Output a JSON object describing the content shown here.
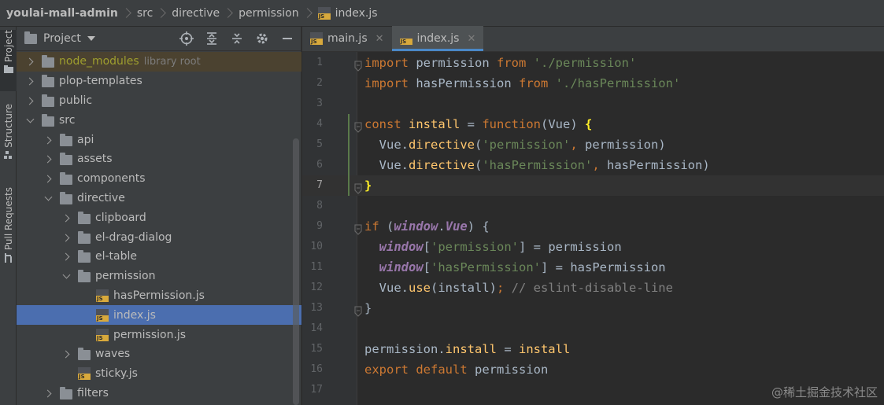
{
  "breadcrumb": {
    "items": [
      "youlai-mall-admin",
      "src",
      "directive",
      "permission",
      "index.js"
    ]
  },
  "toolstrip": {
    "tabs": [
      "Project",
      "Structure",
      "Pull Requests"
    ]
  },
  "project": {
    "title": "Project",
    "tree": [
      {
        "label": "node_modules",
        "extra": "library root",
        "depth": 1,
        "state": "collapsed",
        "type": "folder",
        "excluded": true
      },
      {
        "label": "plop-templates",
        "depth": 1,
        "state": "collapsed",
        "type": "folder"
      },
      {
        "label": "public",
        "depth": 1,
        "state": "collapsed",
        "type": "folder"
      },
      {
        "label": "src",
        "depth": 1,
        "state": "expanded",
        "type": "folder"
      },
      {
        "label": "api",
        "depth": 2,
        "state": "collapsed",
        "type": "folder"
      },
      {
        "label": "assets",
        "depth": 2,
        "state": "collapsed",
        "type": "folder"
      },
      {
        "label": "components",
        "depth": 2,
        "state": "collapsed",
        "type": "folder"
      },
      {
        "label": "directive",
        "depth": 2,
        "state": "expanded",
        "type": "folder"
      },
      {
        "label": "clipboard",
        "depth": 3,
        "state": "collapsed",
        "type": "folder"
      },
      {
        "label": "el-drag-dialog",
        "depth": 3,
        "state": "collapsed",
        "type": "folder"
      },
      {
        "label": "el-table",
        "depth": 3,
        "state": "collapsed",
        "type": "folder"
      },
      {
        "label": "permission",
        "depth": 3,
        "state": "expanded",
        "type": "folder"
      },
      {
        "label": "hasPermission.js",
        "depth": 4,
        "state": "none",
        "type": "js"
      },
      {
        "label": "index.js",
        "depth": 4,
        "state": "none",
        "type": "js",
        "selected": true
      },
      {
        "label": "permission.js",
        "depth": 4,
        "state": "none",
        "type": "js"
      },
      {
        "label": "waves",
        "depth": 3,
        "state": "collapsed",
        "type": "folder"
      },
      {
        "label": "sticky.js",
        "depth": 3,
        "state": "none",
        "type": "js"
      },
      {
        "label": "filters",
        "depth": 2,
        "state": "collapsed",
        "type": "folder"
      }
    ]
  },
  "editor": {
    "tabs": [
      {
        "label": "main.js",
        "active": false
      },
      {
        "label": "index.js",
        "active": true
      }
    ],
    "current_line": 7,
    "lines": [
      [
        [
          "kw",
          "import"
        ],
        [
          "t",
          " permission "
        ],
        [
          "kw",
          "from"
        ],
        [
          "t",
          " "
        ],
        [
          "str",
          "'./permission'"
        ]
      ],
      [
        [
          "kw",
          "import"
        ],
        [
          "t",
          " hasPermission "
        ],
        [
          "kw",
          "from"
        ],
        [
          "t",
          " "
        ],
        [
          "str",
          "'./hasPermission'"
        ]
      ],
      [],
      [
        [
          "kw",
          "const"
        ],
        [
          "t",
          " "
        ],
        [
          "fn",
          "install"
        ],
        [
          "t",
          " = "
        ],
        [
          "kw",
          "function"
        ],
        [
          "t",
          "(Vue) "
        ],
        [
          "brace",
          "{"
        ]
      ],
      [
        [
          "t",
          "  Vue."
        ],
        [
          "fn",
          "directive"
        ],
        [
          "t",
          "("
        ],
        [
          "str",
          "'permission'"
        ],
        [
          "kw",
          ","
        ],
        [
          "t",
          " permission)"
        ]
      ],
      [
        [
          "t",
          "  Vue."
        ],
        [
          "fn",
          "directive"
        ],
        [
          "t",
          "("
        ],
        [
          "str",
          "'hasPermission'"
        ],
        [
          "kw",
          ","
        ],
        [
          "t",
          " hasPermission)"
        ]
      ],
      [
        [
          "brace",
          "}"
        ]
      ],
      [],
      [
        [
          "kw",
          "if"
        ],
        [
          "t",
          " ("
        ],
        [
          "ivar",
          "window"
        ],
        [
          "t",
          "."
        ],
        [
          "ivar",
          "Vue"
        ],
        [
          "t",
          ") {"
        ]
      ],
      [
        [
          "t",
          "  "
        ],
        [
          "ivar",
          "window"
        ],
        [
          "t",
          "["
        ],
        [
          "str",
          "'permission'"
        ],
        [
          "t",
          "] = permission"
        ]
      ],
      [
        [
          "t",
          "  "
        ],
        [
          "ivar",
          "window"
        ],
        [
          "t",
          "["
        ],
        [
          "str",
          "'hasPermission'"
        ],
        [
          "t",
          "] = hasPermission"
        ]
      ],
      [
        [
          "t",
          "  Vue."
        ],
        [
          "fn",
          "use"
        ],
        [
          "t",
          "(install)"
        ],
        [
          "kw",
          ";"
        ],
        [
          "cmt",
          " // eslint-disable-line"
        ]
      ],
      [
        [
          "t",
          "}"
        ]
      ],
      [],
      [
        [
          "t",
          "permission."
        ],
        [
          "fn",
          "install"
        ],
        [
          "t",
          " = "
        ],
        [
          "fn",
          "install"
        ]
      ],
      [
        [
          "kw",
          "export"
        ],
        [
          "t",
          " "
        ],
        [
          "kw",
          "default"
        ],
        [
          "t",
          " permission"
        ]
      ],
      []
    ]
  },
  "watermark": "@稀土掘金技术社区"
}
